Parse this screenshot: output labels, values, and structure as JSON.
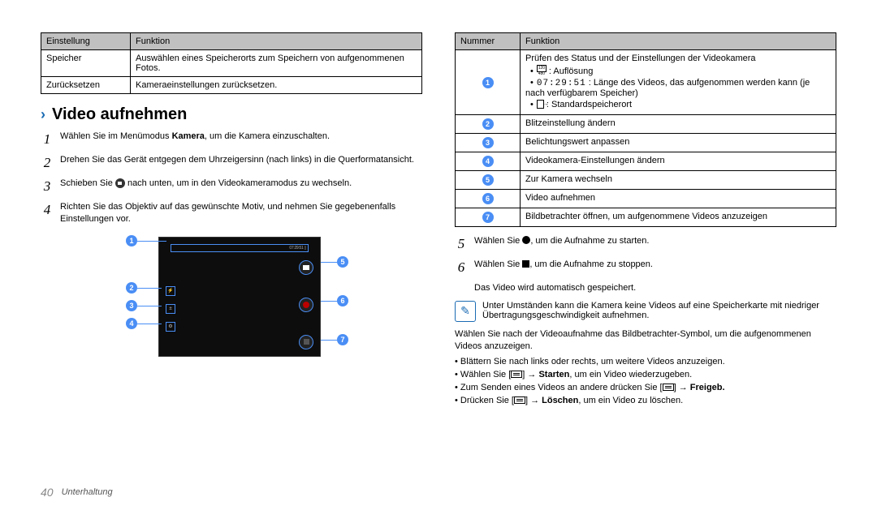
{
  "left_table": {
    "headers": [
      "Einstellung",
      "Funktion"
    ],
    "rows": [
      [
        "Speicher",
        "Auswählen eines Speicherorts zum Speichern von aufgenommenen Fotos."
      ],
      [
        "Zurücksetzen",
        "Kameraeinstellungen zurücksetzen."
      ]
    ]
  },
  "section": {
    "title": "Video aufnehmen",
    "steps": {
      "s1a": "Wählen Sie im Menümodus ",
      "s1b": "Kamera",
      "s1c": ", um die Kamera einzuschalten.",
      "s2": "Drehen Sie das Gerät entgegen dem Uhrzeigersinn (nach links) in die Querformatansicht.",
      "s3a": "Schieben Sie ",
      "s3b": " nach unten, um in den Videokameramodus zu wechseln.",
      "s4": "Richten Sie das Objektiv auf das gewünschte Motiv, und nehmen Sie gegebenenfalls Einstellungen vor."
    }
  },
  "right_table": {
    "headers": [
      "Nummer",
      "Funktion"
    ],
    "row1": {
      "intro": "Prüfen des Status und der Einstellungen der Videokamera",
      "res_label": " : Auflösung",
      "time": "07:29:51",
      "time_text": " : Länge des Videos, das aufgenommen werden kann (je nach verfügbarem Speicher)",
      "storage_label": " : Standardspeicherort"
    },
    "rows": [
      "Blitzeinstellung ändern",
      "Belichtungswert anpassen",
      "Videokamera-Einstellungen ändern",
      "Zur Kamera wechseln",
      "Video aufnehmen",
      "Bildbetrachter öffnen, um aufgenommene Videos anzuzeigen"
    ]
  },
  "after": {
    "s5a": "Wählen Sie ",
    "s5b": ", um die Aufnahme zu starten.",
    "s6a": "Wählen Sie ",
    "s6b": ", um die Aufnahme zu stoppen.",
    "saved": "Das Video wird automatisch gespeichert.",
    "note": "Unter Umständen kann die Kamera keine Videos auf eine Speicherkarte mit niedriger Übertragungsgeschwindigkeit aufnehmen.",
    "para": "Wählen Sie nach der Videoaufnahme das Bildbetrachter-Symbol, um die aufgenommenen Videos anzuzeigen.",
    "b1": "Blättern Sie nach links oder rechts, um weitere Videos anzuzeigen.",
    "b2a": "Wählen Sie [",
    "b2b": "] → ",
    "b2c": "Starten",
    "b2d": ", um ein Video wiederzugeben.",
    "b3a": "Zum Senden eines Videos an andere drücken Sie [",
    "b3b": "] → ",
    "b3c": "Freigeb.",
    "b4a": "Drücken Sie [",
    "b4b": "] → ",
    "b4c": "Löschen",
    "b4d": ", um ein Video zu löschen."
  },
  "footer": {
    "page": "40",
    "section": "Unterhaltung"
  },
  "nums": [
    "1",
    "2",
    "3",
    "4",
    "5",
    "6",
    "7"
  ]
}
